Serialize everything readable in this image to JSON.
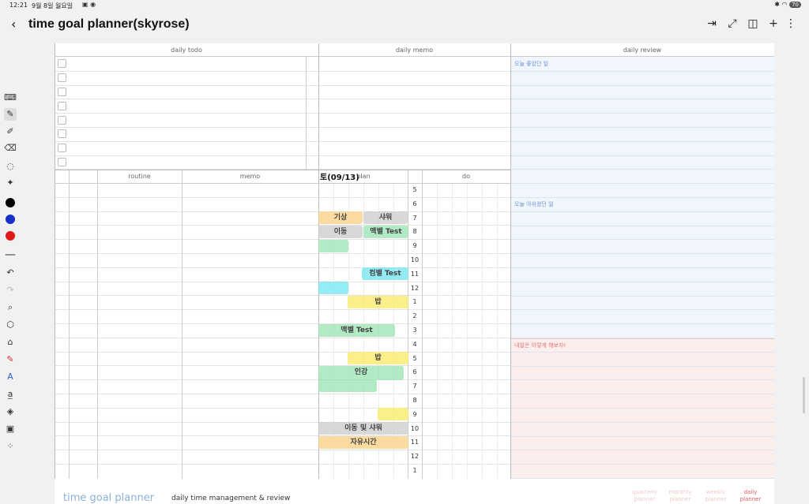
{
  "status": {
    "time": "12:21",
    "date": "9월 8일 월요일",
    "battery": "70"
  },
  "header": {
    "back_icon": "chevron-left-icon",
    "title": "time goal planner(skyrose)"
  },
  "headers": {
    "todo": "daily todo",
    "memo": "daily memo",
    "review": "daily review",
    "routine": "routine",
    "memo2": "memo",
    "plan": "plan",
    "do": "do"
  },
  "date_note": "토(09/13)",
  "review": {
    "good": "오늘 좋았던 일",
    "regret": "오늘 아쉬웠던 일",
    "tomorrow": "내일은 이렇게 해보자!"
  },
  "hours": [
    "5",
    "6",
    "7",
    "8",
    "9",
    "10",
    "11",
    "12",
    "1",
    "2",
    "3",
    "4",
    "5",
    "6",
    "7",
    "8",
    "9",
    "10",
    "11",
    "12",
    "1"
  ],
  "blocks": {
    "b1": "기상",
    "b2": "샤워",
    "b3": "이동",
    "b4": "맥벨 Test",
    "b5": "컴벨 Test",
    "b6": "밥",
    "b7": "맥벨 Test",
    "b8": "밥",
    "b9": "인강",
    "b10": "이동 및 샤워",
    "b11": "자유시간"
  },
  "colors": {
    "review_blue": "#f1f6fd",
    "review_red": "#fdeeee",
    "label_blue": "#6a93d1",
    "label_red": "#e07474",
    "orange": "#fcd38a",
    "gray": "#cfcfcf",
    "green": "#9ee5b7",
    "cyan": "#7be7f2",
    "yellow": "#f9ec6c"
  },
  "footer": {
    "title": "time goal planner",
    "subtitle": "daily time management & review",
    "tabs": [
      "quarterly planner",
      "monthly planner",
      "weekly planner",
      "daily planner"
    ]
  }
}
